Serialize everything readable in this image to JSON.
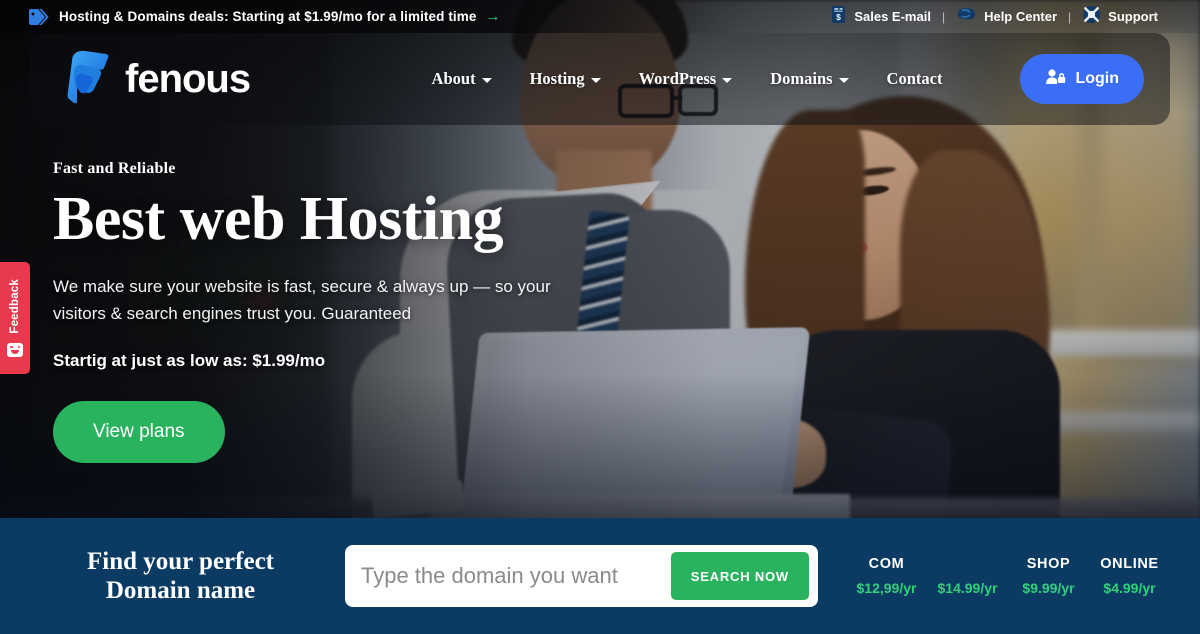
{
  "topbar": {
    "promo_text": "Hosting & Domains deals: Starting at $1.99/mo for a limited time",
    "promo_arrow": "→",
    "tag_icon": "tag-icon",
    "separator": "|",
    "links": [
      {
        "label": "Sales E-mail",
        "icon": "sales-email-icon"
      },
      {
        "label": "Help Center",
        "icon": "help-center-icon"
      },
      {
        "label": "Support",
        "icon": "support-lifebuoy-icon"
      }
    ]
  },
  "header": {
    "brand_name": "fenous",
    "brand_logo_icon": "fenous-f-logo-icon",
    "nav": [
      {
        "label": "About",
        "has_caret": true
      },
      {
        "label": "Hosting",
        "has_caret": true
      },
      {
        "label": "WordPress",
        "has_caret": true
      },
      {
        "label": "Domains",
        "has_caret": true
      },
      {
        "label": "Contact",
        "has_caret": false
      }
    ],
    "login_label": "Login",
    "login_icon": "user-lock-icon",
    "login_color": "#3b6ef6"
  },
  "hero": {
    "eyebrow": "Fast and Reliable",
    "title": "Best web Hosting",
    "subtitle": "We make sure your website is fast, secure & always up — so your visitors & search engines trust you. Guaranteed",
    "price_line": "Startig at just as low as: $1.99/mo",
    "cta_label": "View plans",
    "cta_color": "#2ab35e"
  },
  "feedback": {
    "label": "Feedback",
    "icon": "smiley-face-icon",
    "color": "#e8394e"
  },
  "domain_band": {
    "background_color": "#0b3a63",
    "title_line1": "Find your perfect",
    "title_line2": "Domain name",
    "search_placeholder": "Type the domain you want",
    "search_value": "",
    "search_button_label": "SEARCH NOW",
    "search_button_color": "#2ab35e",
    "price_color": "#2fd27a",
    "tlds": [
      {
        "name": "COM",
        "price": "$12,99/yr"
      },
      {
        "name": "",
        "price": "$14.99/yr"
      },
      {
        "name": "SHOP",
        "price": "$9.99/yr"
      },
      {
        "name": "ONLINE",
        "price": "$4.99/yr"
      }
    ]
  }
}
